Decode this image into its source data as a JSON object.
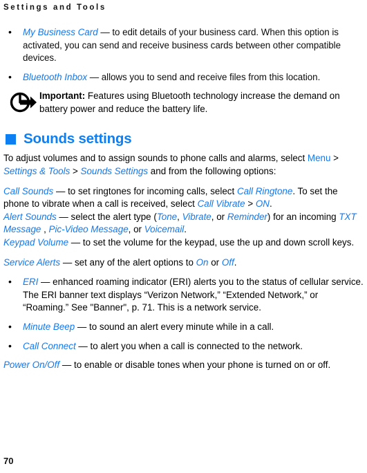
{
  "document": {
    "running_header": "Settings and Tools",
    "page_number": "70",
    "accent_blue": "#0D7FF2",
    "link_blue": "#1379EE",
    "background": "#FFFFFF"
  },
  "bluetooth_bullets": [
    {
      "term": "My Business Card",
      "dash": " — ",
      "description": "to edit details of your business card. When this option is activated, you can send and receive business cards between other compatible devices."
    },
    {
      "term": "Bluetooth Inbox",
      "dash": " — ",
      "description": "allows you to send and receive files from this location."
    }
  ],
  "important_note": {
    "icon": "important-arrow-icon",
    "label": "Important:",
    "text": " Features using Bluetooth technology increase the demand on battery power and reduce the battery life."
  },
  "sounds_section": {
    "heading": "Sounds settings",
    "bullet_icon": "blue-square-bullet",
    "intro": {
      "part1": "To adjust volumes and to assign sounds to phone calls and alarms, select ",
      "menu": "Menu",
      "sep1": " > ",
      "settings_tools": "Settings & Tools",
      "sep2": " > ",
      "sounds_settings": "Sounds Settings",
      "part2": " and from the following options:"
    },
    "call_sounds": {
      "term": "Call Sounds ",
      "dash": "— ",
      "text1": "to set ringtones for incoming calls, select ",
      "call_ringtone": "Call Ringtone",
      "text2": ". To set the phone to vibrate when a call is received, select ",
      "call_vibrate": "Call Vibrate",
      "sep": " > ",
      "on": "ON",
      "text3": "."
    },
    "alert_sounds": {
      "term": "Alert Sounds",
      "dash": " — ",
      "text1": "select the alert type (",
      "tone": "Tone",
      "comma1": ", ",
      "vibrate": "Vibrate",
      "comma2": ", or ",
      "reminder": "Reminder",
      "text2": ") for an incoming ",
      "txt_message": "TXT Message ",
      "comma3": ", ",
      "pic_video": "Pic-Video Message",
      "comma4": ", or ",
      "voicemail": "Voicemail",
      "text3": "."
    },
    "keypad_volume": {
      "term": "Keypad Volume",
      "dash": " — ",
      "text": "to set the volume for the keypad, use the up and down scroll keys."
    },
    "service_alerts": {
      "term": "Service Alerts",
      "dash": " — ",
      "text1": "set any of the alert options to ",
      "on": "On",
      "text2": " or ",
      "off": "Off",
      "text3": "."
    },
    "bullets": [
      {
        "term": "ERI",
        "dash": " — ",
        "description": "enhanced roaming indicator (ERI) alerts you to the status of cellular service. The ERI banner text displays “Verizon Network,” “Extended Network,” or “Roaming.” See \"Banner\", p. 71. This is a network service."
      },
      {
        "term": "Minute Beep",
        "dash": " — ",
        "description": "to sound an alert every minute while in a call."
      },
      {
        "term": "Call Connect",
        "dash": " — ",
        "description": "to alert you when a call is connected to the network."
      }
    ],
    "power_on_off": {
      "term": "Power On/Off",
      "dash": " — ",
      "text": "to enable or disable tones when your phone is turned on or off."
    }
  }
}
